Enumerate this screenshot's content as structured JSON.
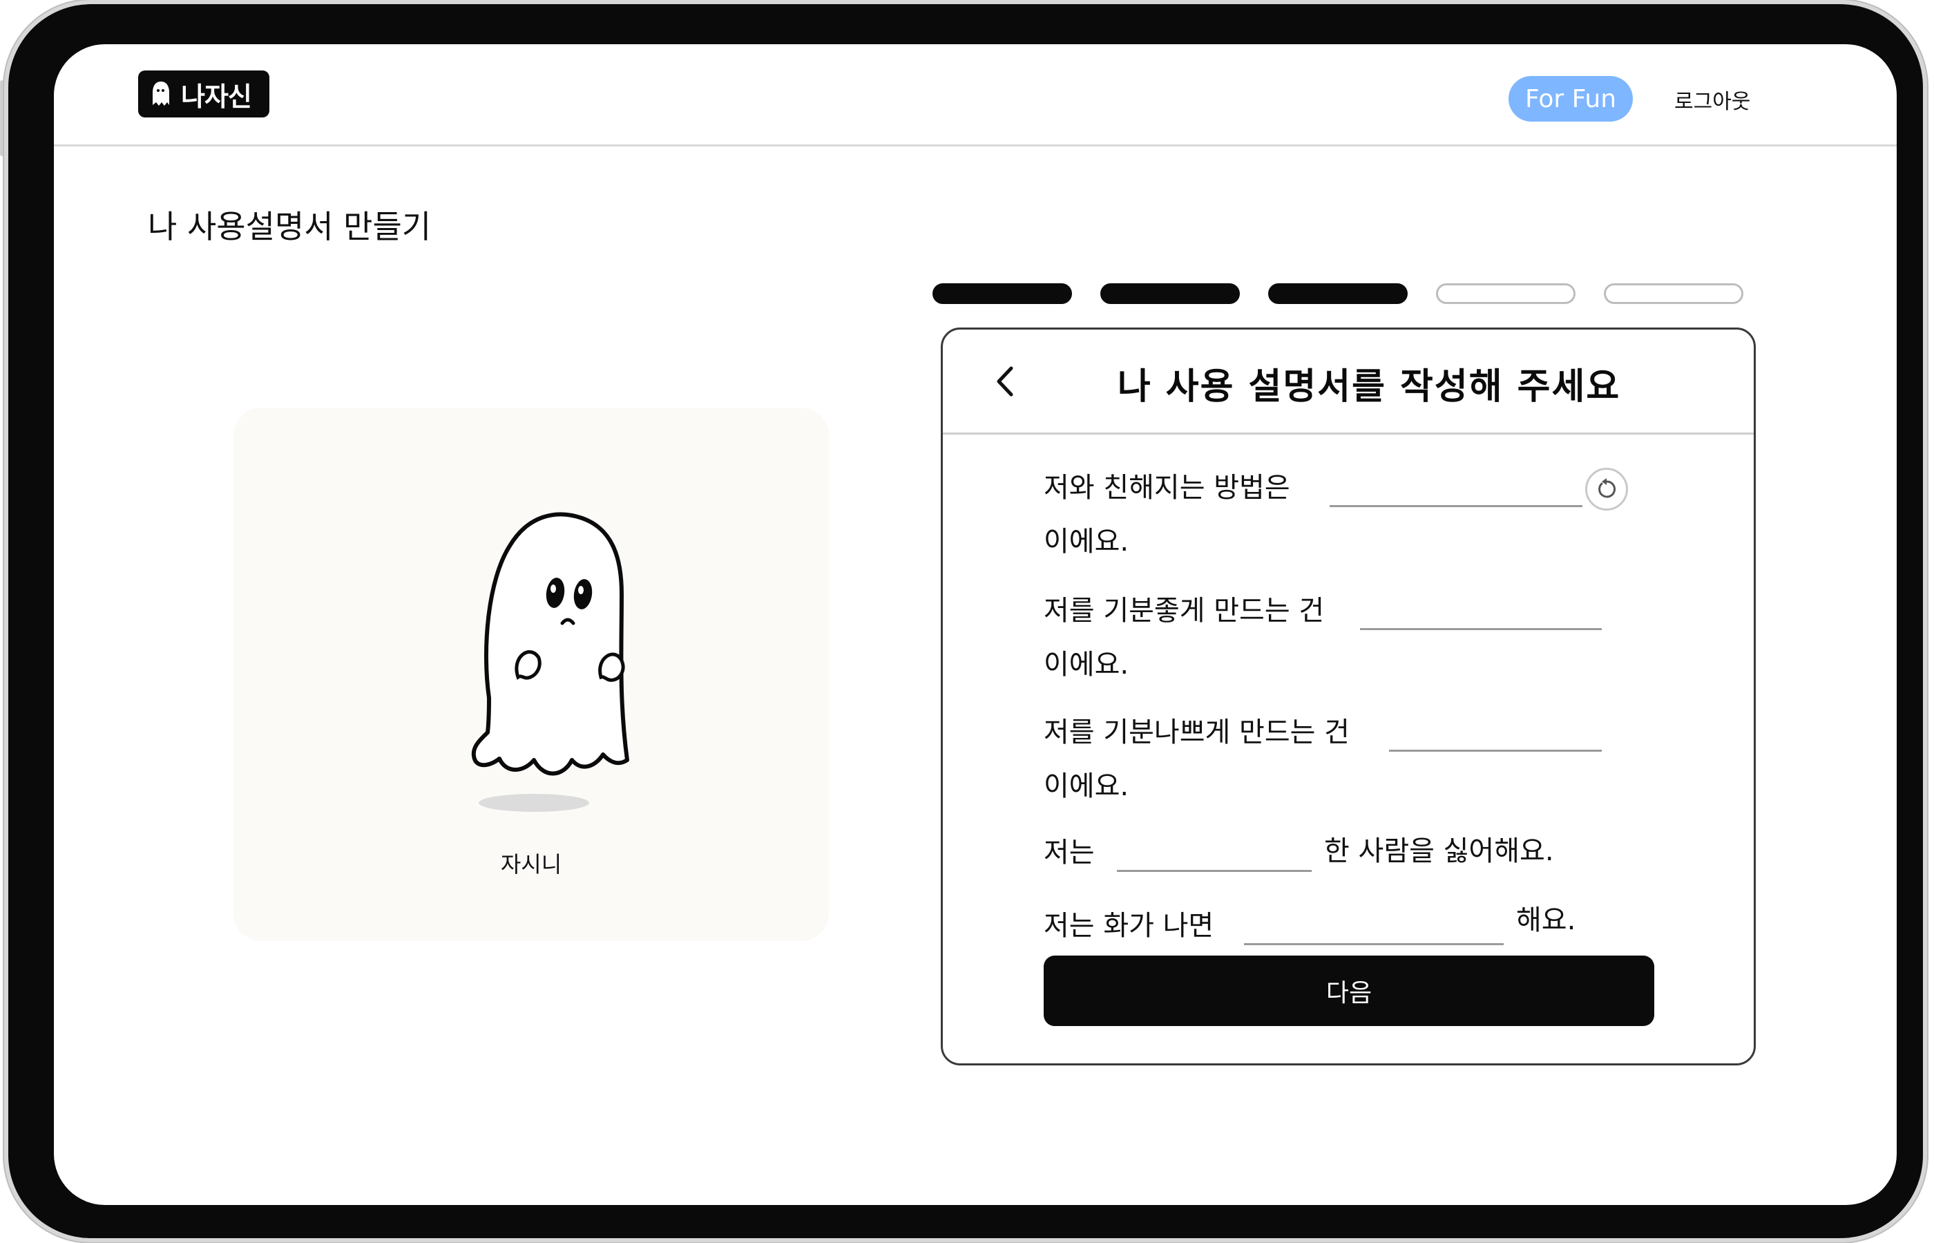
{
  "header": {
    "logo_text": "나자신",
    "for_fun_label": "For Fun",
    "logout_label": "로그아웃"
  },
  "page": {
    "title": "나 사용설명서 만들기"
  },
  "character": {
    "name": "자시니"
  },
  "progress": {
    "total_steps": 5,
    "completed_steps": 3
  },
  "form": {
    "title": "나 사용 설명서를 작성해 주세요",
    "questions": [
      {
        "before": "저와 친해지는 방법은",
        "after": "이에요."
      },
      {
        "before": "저를 기분좋게 만드는 건",
        "after": "이에요."
      },
      {
        "before": "저를 기분나쁘게 만드는 건",
        "after": "이에요."
      },
      {
        "before": "저는",
        "after": "한 사람을 싫어해요."
      },
      {
        "before": "저는 화가 나면",
        "after": "해요."
      }
    ],
    "next_label": "다음"
  },
  "colors": {
    "accent": "#7eb6ff",
    "primary": "#0b0b0b",
    "card_bg": "#fbfaf7"
  },
  "icons": [
    "ghost-icon",
    "chevron-left-icon",
    "reset-icon"
  ]
}
